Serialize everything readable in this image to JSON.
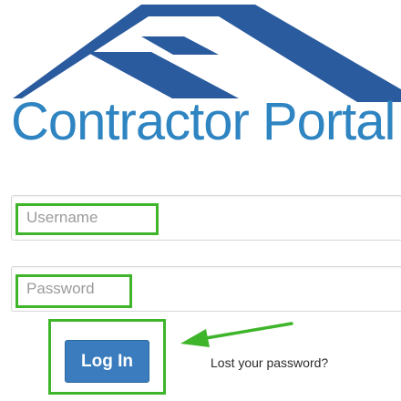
{
  "brand": {
    "title": "Contractor Portal",
    "logo_icon": "house-roof-icon",
    "colors": {
      "roof_dark": "#2a5b9e",
      "title_blue": "#2f84c2"
    }
  },
  "login_form": {
    "username": {
      "placeholder": "Username",
      "value": ""
    },
    "password": {
      "placeholder": "Password",
      "value": ""
    },
    "login_label": "Log In",
    "lost_password_label": "Lost your password?"
  },
  "annotations": {
    "highlight_color": "#3fb52b",
    "arrow_icon": "green-arrow-icon"
  }
}
